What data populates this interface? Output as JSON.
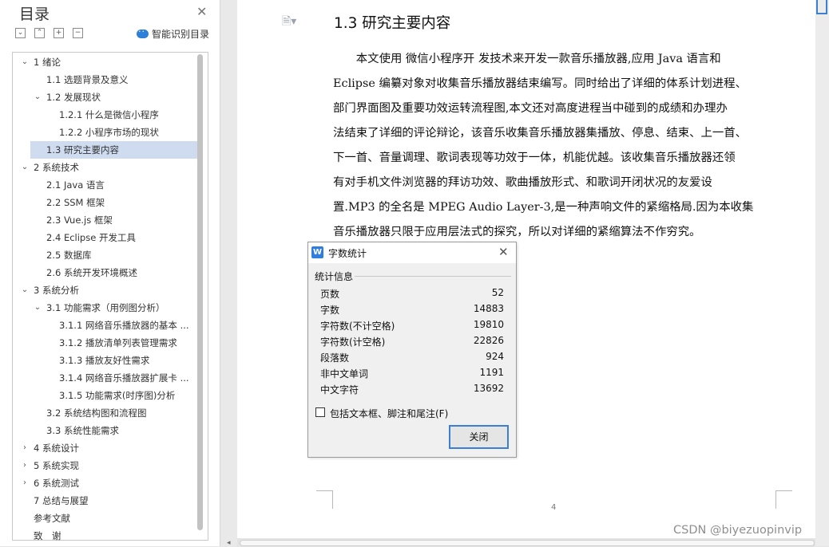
{
  "toc": {
    "title": "目录",
    "smart_label": "智能识别目录",
    "toolbar": [
      "⌄",
      "⌃",
      "+",
      "−"
    ],
    "items": [
      {
        "label": "1 绪论",
        "arrow": "⌄"
      },
      {
        "label": "1.1 选题背景及意义",
        "arrow": ""
      },
      {
        "label": "1.2 发展现状",
        "arrow": "⌄"
      },
      {
        "label": "1.2.1 什么是微信小程序",
        "arrow": ""
      },
      {
        "label": "1.2.2 小程序市场的现状",
        "arrow": ""
      },
      {
        "label": "1.3 研究主要内容",
        "arrow": "",
        "selected": true
      },
      {
        "label": "2 系统技术",
        "arrow": "⌄"
      },
      {
        "label": "2.1 Java 语言",
        "arrow": ""
      },
      {
        "label": "2.2 SSM 框架",
        "arrow": ""
      },
      {
        "label": "2.3 Vue.js 框架",
        "arrow": ""
      },
      {
        "label": "2.4 Eclipse 开发工具",
        "arrow": ""
      },
      {
        "label": "2.5 数据库",
        "arrow": ""
      },
      {
        "label": "2.6 系统开发环境概述",
        "arrow": ""
      },
      {
        "label": "3 系统分析",
        "arrow": "⌄"
      },
      {
        "label": "3.1  功能需求（用例图分析）",
        "arrow": "⌄"
      },
      {
        "label": "3.1.1  网络音乐播放器的基本 ...",
        "arrow": ""
      },
      {
        "label": "3.1.2  播放清单列表管理需求",
        "arrow": ""
      },
      {
        "label": "3.1.3  播放友好性需求",
        "arrow": ""
      },
      {
        "label": "3.1.4  网络音乐播放器扩展卡 ...",
        "arrow": ""
      },
      {
        "label": "3.1.5  功能需求(时序图)分析",
        "arrow": ""
      },
      {
        "label": "3.2  系统结构图和流程图",
        "arrow": ""
      },
      {
        "label": "3.3  系统性能需求",
        "arrow": ""
      },
      {
        "label": "4 系统设计",
        "arrow": "›"
      },
      {
        "label": "5 系统实现",
        "arrow": "›"
      },
      {
        "label": "6 系统测试",
        "arrow": "›"
      },
      {
        "label": "7 总结与展望",
        "arrow": ""
      },
      {
        "label": "参考文献",
        "arrow": ""
      },
      {
        "label": "致　谢",
        "arrow": ""
      }
    ]
  },
  "document": {
    "heading": "1.3 研究主要内容",
    "lines": [
      "　　本文使用 微信小程序开 发技术来开发一款音乐播放器,应用  Java 语言和",
      "Eclipse 编纂对象对收集音乐播放器结束编写。同时给出了详细的体系计划进程、",
      "部门界面图及重要功效运转流程图,本文还对高度进程当中碰到的成绩和办理办",
      "法结束了详细的评论辩论，该音乐收集音乐播放器集播放、停息、结束、上一首、",
      "下一首、音量调理、歌词表现等功效于一体，机能优越。该收集音乐播放器还领",
      "有对手机文件浏览器的拜访功效、歌曲播放形式、和歌词开闭状况的友爱设",
      "置.MP3 的全名是 MPEG Audio Layer-3,是一种声响文件的紧缩格局.因为本收集",
      "音乐播放器只限于应用层法式的探究，所以对详细的紧缩算法不作穷究。"
    ],
    "page_number": "4"
  },
  "word_count": {
    "title": "字数统计",
    "group_label": "统计信息",
    "rows": [
      {
        "label": "页数",
        "value": "52"
      },
      {
        "label": "字数",
        "value": "14883"
      },
      {
        "label": "字符数(不计空格)",
        "value": "19810"
      },
      {
        "label": "字符数(计空格)",
        "value": "22826"
      },
      {
        "label": "段落数",
        "value": "924"
      },
      {
        "label": "非中文单词",
        "value": "1191"
      },
      {
        "label": "中文字符",
        "value": "13692"
      }
    ],
    "checkbox_label": "包括文本框、脚注和尾注(F)",
    "checkbox_checked": false,
    "close_label": "关闭"
  },
  "watermark": "CSDN @biyezuopinvip",
  "colors": {
    "selected_bg": "#cfdcf0",
    "accent": "#3c7fd1"
  }
}
